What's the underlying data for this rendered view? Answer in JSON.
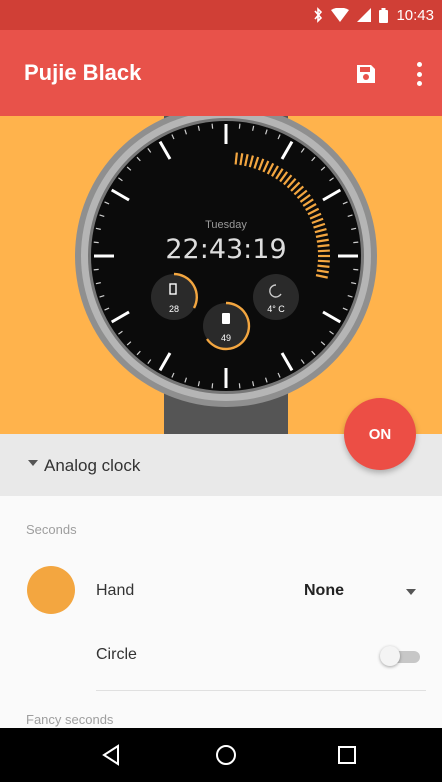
{
  "status_bar": {
    "time": "10:43",
    "icons": [
      "bluetooth-icon",
      "wifi-icon",
      "signal-icon",
      "battery-icon"
    ]
  },
  "app_bar": {
    "title": "Pujie Black",
    "actions": [
      "save-icon",
      "more-vert-icon"
    ]
  },
  "watch_face": {
    "day": "Tuesday",
    "time": "22:43:19",
    "complications": [
      {
        "icon": "phone-icon",
        "value": "28"
      },
      {
        "icon": "battery-icon",
        "value": "49"
      },
      {
        "icon": "weather-icon",
        "value": "4° C"
      }
    ]
  },
  "fab": {
    "label": "ON"
  },
  "section": {
    "label": "Analog clock"
  },
  "seconds": {
    "header": "Seconds",
    "hand_label": "Hand",
    "hand_value": "None",
    "circle_label": "Circle",
    "circle_enabled": false
  },
  "fancy_seconds": {
    "header": "Fancy seconds"
  },
  "nav": [
    "back-icon",
    "home-icon",
    "recents-icon"
  ],
  "colors": {
    "status_bar": "#d03f36",
    "app_bar": "#e8524a",
    "preview_bg": "#ffb34c",
    "accent_orange": "#f3a640",
    "fab": "#ec4e45"
  }
}
